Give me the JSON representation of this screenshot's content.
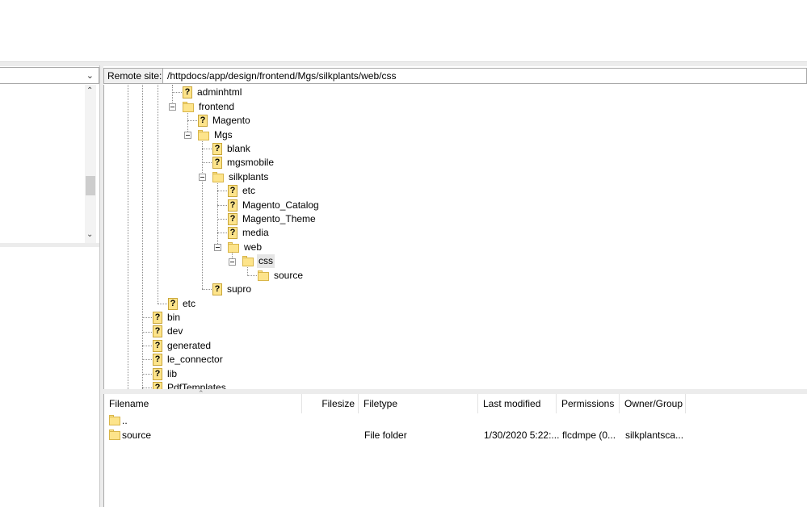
{
  "remote_site": {
    "label": "Remote site:",
    "path": "/httpdocs/app/design/frontend/Mgs/silkplants/web/css"
  },
  "tree": {
    "nodes": [
      {
        "label": "adminhtml",
        "icon": "question-folder-icon"
      },
      {
        "label": "frontend",
        "icon": "folder-icon",
        "expanded": true
      },
      {
        "label": "Magento",
        "icon": "question-folder-icon"
      },
      {
        "label": "Mgs",
        "icon": "folder-icon",
        "expanded": true
      },
      {
        "label": "blank",
        "icon": "question-folder-icon"
      },
      {
        "label": "mgsmobile",
        "icon": "question-folder-icon"
      },
      {
        "label": "silkplants",
        "icon": "folder-icon",
        "expanded": true
      },
      {
        "label": "etc",
        "icon": "question-folder-icon"
      },
      {
        "label": "Magento_Catalog",
        "icon": "question-folder-icon"
      },
      {
        "label": "Magento_Theme",
        "icon": "question-folder-icon"
      },
      {
        "label": "media",
        "icon": "question-folder-icon"
      },
      {
        "label": "web",
        "icon": "folder-icon",
        "expanded": true
      },
      {
        "label": "css",
        "icon": "folder-icon",
        "expanded": true,
        "selected": true
      },
      {
        "label": "source",
        "icon": "folder-icon"
      },
      {
        "label": "supro",
        "icon": "question-folder-icon"
      },
      {
        "label": "etc",
        "icon": "question-folder-icon"
      },
      {
        "label": "bin",
        "icon": "question-folder-icon"
      },
      {
        "label": "dev",
        "icon": "question-folder-icon"
      },
      {
        "label": "generated",
        "icon": "question-folder-icon"
      },
      {
        "label": "le_connector",
        "icon": "question-folder-icon"
      },
      {
        "label": "lib",
        "icon": "question-folder-icon"
      },
      {
        "label": "PdfTemplates",
        "icon": "question-folder-icon"
      }
    ]
  },
  "file_list": {
    "columns": [
      "Filename",
      "Filesize",
      "Filetype",
      "Last modified",
      "Permissions",
      "Owner/Group"
    ],
    "rows": [
      {
        "filename": "..",
        "filesize": "",
        "filetype": "",
        "modified": "",
        "permissions": "",
        "owner": ""
      },
      {
        "filename": "source",
        "filesize": "",
        "filetype": "File folder",
        "modified": "1/30/2020 5:22:...",
        "permissions": "flcdmpe (0...",
        "owner": "silkplantsca..."
      }
    ]
  }
}
